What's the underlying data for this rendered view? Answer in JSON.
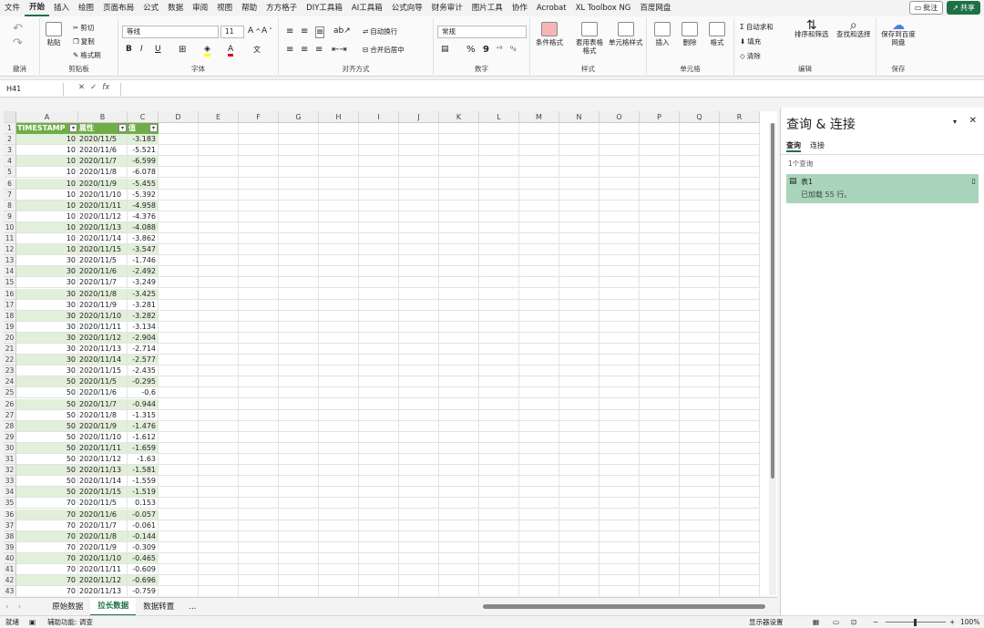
{
  "menu": {
    "items": [
      "文件",
      "开始",
      "插入",
      "绘图",
      "页面布局",
      "公式",
      "数据",
      "审阅",
      "视图",
      "帮助",
      "方方格子",
      "DIY工具箱",
      "AI工具箱",
      "公式向导",
      "财务审计",
      "图片工具",
      "协作",
      "Acrobat",
      "XL Toolbox NG",
      "百度网盘"
    ],
    "active_index": 1,
    "comment": "批注",
    "share": "共享"
  },
  "ribbon": {
    "groups": [
      "撤消",
      "剪贴板",
      "字体",
      "对齐方式",
      "数字",
      "样式",
      "单元格",
      "编辑",
      "保存"
    ],
    "clipboard": {
      "paste": "粘贴",
      "cut": "剪切",
      "copy": "复制",
      "painter": "格式刷"
    },
    "font": {
      "name": "等线",
      "size": "11",
      "bold": "B",
      "italic": "I",
      "underline": "U"
    },
    "align": {
      "wrap": "自动换行",
      "merge": "合并后居中"
    },
    "number": {
      "format": "常规",
      "percent": "%",
      "comma": "9"
    },
    "styles": {
      "cond": "条件格式",
      "table": "套用表格格式",
      "cell": "单元格样式"
    },
    "cells": {
      "insert": "插入",
      "delete": "删除",
      "format": "格式"
    },
    "editing": {
      "autosum": "自动求和",
      "fill": "填充",
      "clear": "清除",
      "sort": "排序和筛选",
      "find": "查找和选择"
    },
    "save": {
      "label": "保存到百度网盘"
    }
  },
  "formula_bar": {
    "namebox": "H41",
    "fx": "fx",
    "content": ""
  },
  "columns": [
    "A",
    "B",
    "C",
    "D",
    "E",
    "F",
    "G",
    "H",
    "I",
    "J",
    "K",
    "L",
    "M",
    "N",
    "O",
    "P",
    "Q",
    "R"
  ],
  "table": {
    "headers": [
      "TIMESTAMP",
      "属性",
      "值"
    ],
    "rows": [
      [
        "10",
        "2020/11/5",
        "-3.183"
      ],
      [
        "10",
        "2020/11/6",
        "-5.521"
      ],
      [
        "10",
        "2020/11/7",
        "-6.599"
      ],
      [
        "10",
        "2020/11/8",
        "-6.078"
      ],
      [
        "10",
        "2020/11/9",
        "-5.455"
      ],
      [
        "10",
        "2020/11/10",
        "-5.392"
      ],
      [
        "10",
        "2020/11/11",
        "-4.958"
      ],
      [
        "10",
        "2020/11/12",
        "-4.376"
      ],
      [
        "10",
        "2020/11/13",
        "-4.088"
      ],
      [
        "10",
        "2020/11/14",
        "-3.862"
      ],
      [
        "10",
        "2020/11/15",
        "-3.547"
      ],
      [
        "30",
        "2020/11/5",
        "-1.746"
      ],
      [
        "30",
        "2020/11/6",
        "-2.492"
      ],
      [
        "30",
        "2020/11/7",
        "-3.249"
      ],
      [
        "30",
        "2020/11/8",
        "-3.425"
      ],
      [
        "30",
        "2020/11/9",
        "-3.281"
      ],
      [
        "30",
        "2020/11/10",
        "-3.282"
      ],
      [
        "30",
        "2020/11/11",
        "-3.134"
      ],
      [
        "30",
        "2020/11/12",
        "-2.904"
      ],
      [
        "30",
        "2020/11/13",
        "-2.714"
      ],
      [
        "30",
        "2020/11/14",
        "-2.577"
      ],
      [
        "30",
        "2020/11/15",
        "-2.435"
      ],
      [
        "50",
        "2020/11/5",
        "-0.295"
      ],
      [
        "50",
        "2020/11/6",
        "-0.6"
      ],
      [
        "50",
        "2020/11/7",
        "-0.944"
      ],
      [
        "50",
        "2020/11/8",
        "-1.315"
      ],
      [
        "50",
        "2020/11/9",
        "-1.476"
      ],
      [
        "50",
        "2020/11/10",
        "-1.612"
      ],
      [
        "50",
        "2020/11/11",
        "-1.659"
      ],
      [
        "50",
        "2020/11/12",
        "-1.63"
      ],
      [
        "50",
        "2020/11/13",
        "-1.581"
      ],
      [
        "50",
        "2020/11/14",
        "-1.559"
      ],
      [
        "50",
        "2020/11/15",
        "-1.519"
      ],
      [
        "70",
        "2020/11/5",
        "0.153"
      ],
      [
        "70",
        "2020/11/6",
        "-0.057"
      ],
      [
        "70",
        "2020/11/7",
        "-0.061"
      ],
      [
        "70",
        "2020/11/8",
        "-0.144"
      ],
      [
        "70",
        "2020/11/9",
        "-0.309"
      ],
      [
        "70",
        "2020/11/10",
        "-0.465"
      ],
      [
        "70",
        "2020/11/11",
        "-0.609"
      ],
      [
        "70",
        "2020/11/12",
        "-0.696"
      ],
      [
        "70",
        "2020/11/13",
        "-0.759"
      ]
    ]
  },
  "sheet_tabs": [
    "原始数据",
    "拉长数据",
    "数据转置"
  ],
  "active_sheet": 1,
  "tab_more": "...",
  "pane": {
    "title": "查询 & 连接",
    "tabs": [
      "查询",
      "连接"
    ],
    "count": "1个查询",
    "query_name": "表1",
    "query_status": "已加载 55 行。"
  },
  "status": {
    "ready": "就绪",
    "accessibility": "辅助功能: 调查",
    "display": "显示器设置",
    "zoom": "100%"
  }
}
